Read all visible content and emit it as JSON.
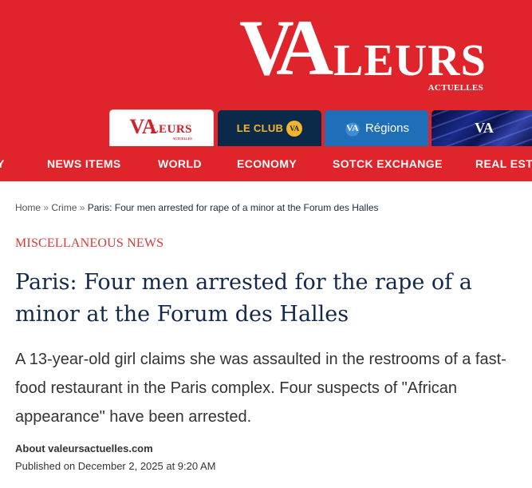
{
  "brand": {
    "logo_v": "V",
    "logo_a": "A",
    "logo_rest": "LEURS",
    "logo_sub": "ACTUELLES",
    "accent_color": "#e0242b",
    "navy_color": "#13294b"
  },
  "tabs": {
    "va": {
      "v": "VA",
      "rest": "LEURS",
      "sub": "ACTUELLES"
    },
    "club": {
      "label": "LE CLUB",
      "badge": "VA"
    },
    "regions": {
      "icon_text": "VA",
      "label": "Régions"
    },
    "va_plus": {
      "label": "VA"
    }
  },
  "nav": {
    "items": [
      "Y",
      "NEWS ITEMS",
      "WORLD",
      "ECONOMY",
      "SOTCK EXCHANGE",
      "REAL ESTA"
    ]
  },
  "breadcrumb": {
    "home": "Home",
    "sep": "»",
    "crime": "Crime",
    "current": "Paris: Four men arrested for rape of a minor at the Forum des Halles"
  },
  "article": {
    "category": "MISCELLANEOUS NEWS",
    "title": "Paris: Four men arrested for the rape of a minor at the Forum des Halles",
    "lede": "A 13-year-old girl claims she was assaulted in the restrooms of a fast-food restaurant in the Paris complex. Four suspects of \"African appearance\" have been arrested.",
    "author": "About valeursactuelles.com",
    "published": "Published on December 2, 2025 at 9:20 AM"
  }
}
